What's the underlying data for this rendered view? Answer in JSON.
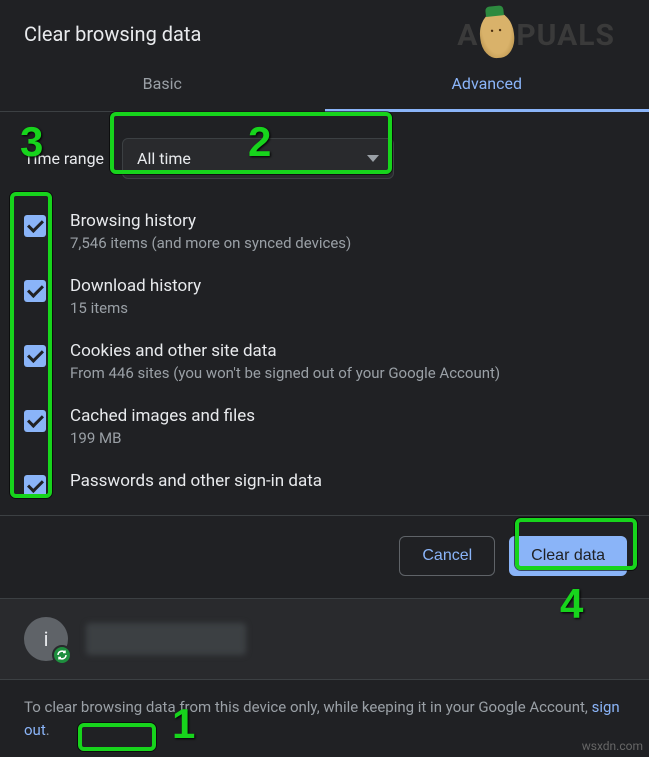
{
  "title": "Clear browsing data",
  "tabs": {
    "basic": "Basic",
    "advanced": "Advanced"
  },
  "range": {
    "label": "Time range",
    "selected": "All time"
  },
  "options": [
    {
      "title": "Browsing history",
      "sub": "7,546 items (and more on synced devices)"
    },
    {
      "title": "Download history",
      "sub": "15 items"
    },
    {
      "title": "Cookies and other site data",
      "sub": "From 446 sites (you won't be signed out of your Google Account)"
    },
    {
      "title": "Cached images and files",
      "sub": "199 MB"
    },
    {
      "title": "Passwords and other sign-in data",
      "sub": ""
    }
  ],
  "buttons": {
    "cancel": "Cancel",
    "clear": "Clear data"
  },
  "avatar_initial": "i",
  "notice": {
    "pre": "To clear browsing data from this device only, while keeping it in your Google Account, ",
    "link": "sign out",
    "post": "."
  },
  "annotations": {
    "n1": "1",
    "n2": "2",
    "n3": "3",
    "n4": "4"
  },
  "watermark": {
    "brand_left": "A",
    "brand_right": "PUALS",
    "site": "wsxdn.com"
  }
}
